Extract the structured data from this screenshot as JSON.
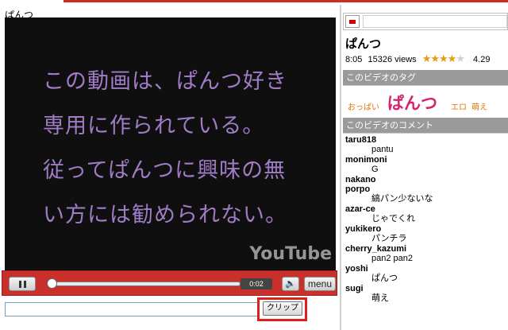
{
  "page": {
    "title": "ぱんつ"
  },
  "video": {
    "overlay_lines": [
      "この動画は、ぱんつ好き",
      "専用に作られている。",
      "従ってぱんつに興味の無",
      "い方には勧められない。"
    ],
    "watermark": "YouTube"
  },
  "player": {
    "time": "0:02",
    "progress": 0.0,
    "menu_label": "menu"
  },
  "clip": {
    "button_label": "クリップ",
    "input_value": ""
  },
  "sidebar": {
    "title": "ぱんつ",
    "duration": "8:05",
    "views": "15326 views",
    "rating": "4.29",
    "rating_stars": 4,
    "tags_header": "このビデオのタグ",
    "tags": [
      "おっぱい",
      "ぱんつ",
      "エロ",
      "萌え"
    ],
    "comments_header": "このビデオのコメント",
    "comments": [
      {
        "user": "taru818",
        "text": "pantu"
      },
      {
        "user": "monimoni",
        "text": "G"
      },
      {
        "user": "nakano",
        "text": ""
      },
      {
        "user": "porpo",
        "text": "縞パン少ないな"
      },
      {
        "user": "azar-ce",
        "text": "じゃでくれ"
      },
      {
        "user": "yukikero",
        "text": "パンチラ"
      },
      {
        "user": "cherry_kazumi",
        "text": "pan2 pan2"
      },
      {
        "user": "yoshi",
        "text": "ぱんつ"
      },
      {
        "user": "sugi",
        "text": "萌え"
      }
    ]
  },
  "colors": {
    "accent_red": "#d22a1e",
    "overlay_text": "#a07cc6",
    "tag_pink": "#d8206f",
    "tag_orange": "#e07400",
    "section_gray": "#9a9a9a"
  }
}
